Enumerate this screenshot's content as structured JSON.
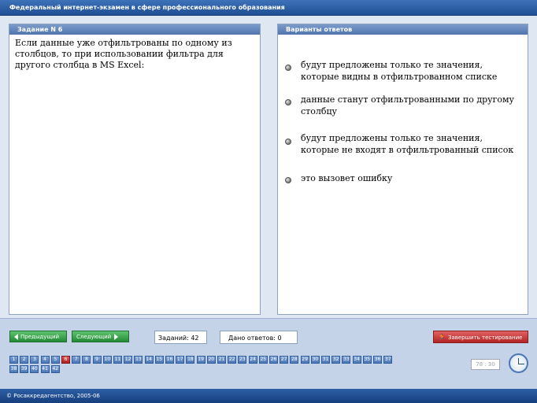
{
  "header": {
    "title": "Федеральный интернет-экзамен в сфере профессионального образования"
  },
  "question_panel": {
    "heading": "Задание N 6",
    "text": "Если данные уже отфильтрованы по одному из столбцов, то при использовании фильтра для другого столбца в MS Excel:"
  },
  "answers_panel": {
    "heading": "Варианты ответов",
    "options": [
      "будут предложены только те значения, которые видны в отфильтрованном списке",
      "данные станут отфильтрованными по другому столбцу",
      "будут предложены только те значения, которые не входят в отфильтрованный список",
      "это вызовет ошибку"
    ]
  },
  "toolbar": {
    "prev_label": "Предыдущий",
    "next_label": "Следующий",
    "tasks_count": "Заданий: 42",
    "answered_count": "Дано ответов: 0",
    "finish_label": "Завершить тестирование"
  },
  "question_numbers": [
    "1",
    "2",
    "3",
    "4",
    "5",
    "6",
    "7",
    "8",
    "9",
    "10",
    "11",
    "12",
    "13",
    "14",
    "15",
    "16",
    "17",
    "18",
    "19",
    "20",
    "21",
    "22",
    "23",
    "24",
    "25",
    "26",
    "27",
    "28",
    "29",
    "30",
    "31",
    "32",
    "33",
    "34",
    "35",
    "36",
    "37",
    "38",
    "39",
    "40",
    "41",
    "42"
  ],
  "active_question": "6",
  "timer": {
    "value": "78 : 30"
  },
  "footer": {
    "copyright": "© Росаккредагентство, 2005-06"
  },
  "colors": {
    "accent": "#1f4f95",
    "active_number": "#c62828",
    "nav_button": "#2e9a44",
    "finish_button": "#c43535"
  }
}
